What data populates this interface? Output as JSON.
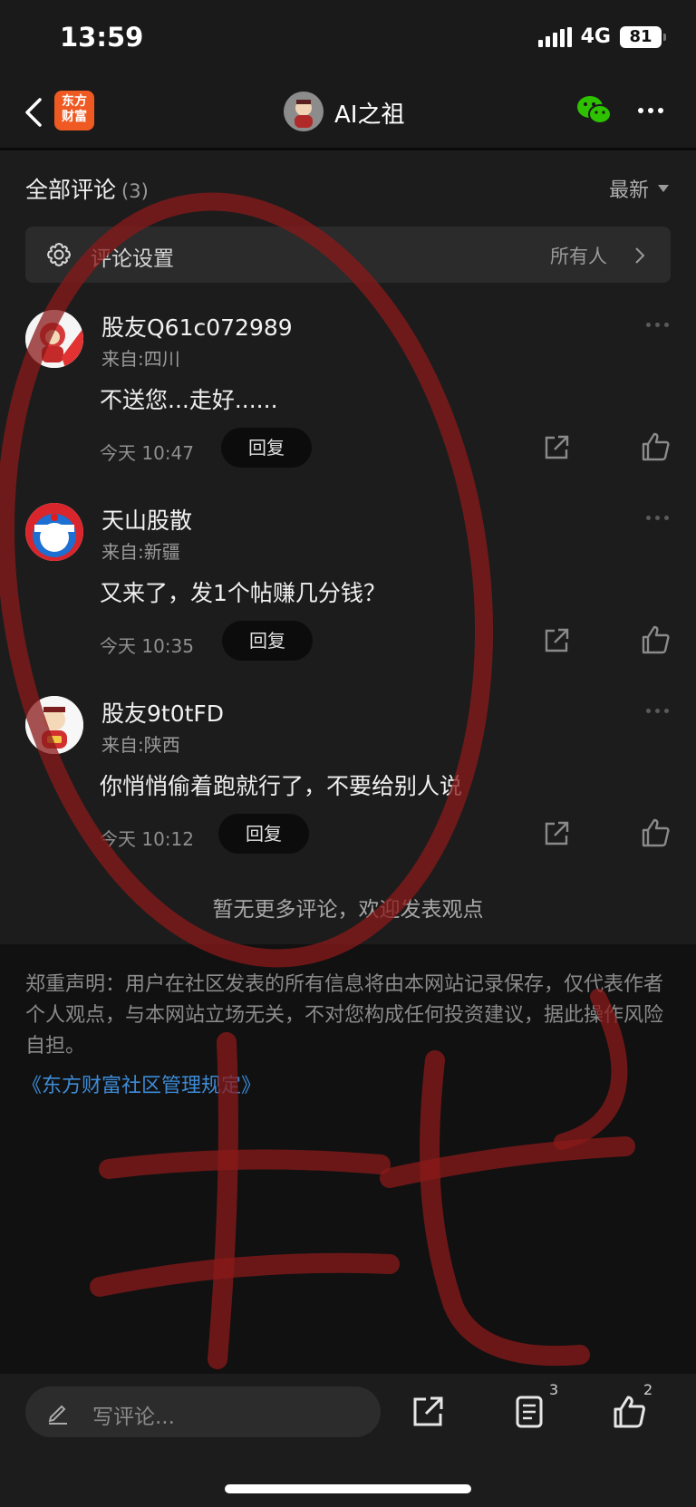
{
  "status": {
    "time": "13:59",
    "network": "4G",
    "battery": "81"
  },
  "nav": {
    "brand": "东方\n财富",
    "title": "AI之祖"
  },
  "comments_header": {
    "title": "全部评论",
    "count": "(3)",
    "sort": "最新"
  },
  "settings": {
    "label": "评论设置",
    "value": "所有人"
  },
  "comments": [
    {
      "user": "股友Q61c072989",
      "location": "来自:四川",
      "text": "不送您...走好......",
      "time": "今天 10:47",
      "reply": "回复"
    },
    {
      "user": "天山股散",
      "location": "来自:新疆",
      "text": "又来了，发1个帖赚几分钱？",
      "time": "今天 10:35",
      "reply": "回复"
    },
    {
      "user": "股友9t0tFD",
      "location": "来自:陕西",
      "text": "你悄悄偷着跑就行了，不要给别人说",
      "time": "今天 10:12",
      "reply": "回复"
    }
  ],
  "no_more": "暂无更多评论，欢迎发表观点",
  "disclaimer": "郑重声明：用户在社区发表的所有信息将由本网站记录保存，仅代表作者个人观点，与本网站立场无关，不对您构成任何投资建议，据此操作风险自担。",
  "rules_link": "《东方财富社区管理规定》",
  "bottom": {
    "placeholder": "写评论...",
    "comment_count": "3",
    "like_count": "2"
  },
  "colors": {
    "watermark": "#8b1a1a",
    "link": "#3d8bd6",
    "brand": "#ef5a23",
    "wechat": "#2dc100"
  },
  "icons": [
    "back-icon",
    "wechat-icon",
    "more-icon",
    "gear-icon",
    "chevron-right-icon",
    "share-icon",
    "like-icon",
    "pen-icon",
    "comment-list-icon"
  ]
}
